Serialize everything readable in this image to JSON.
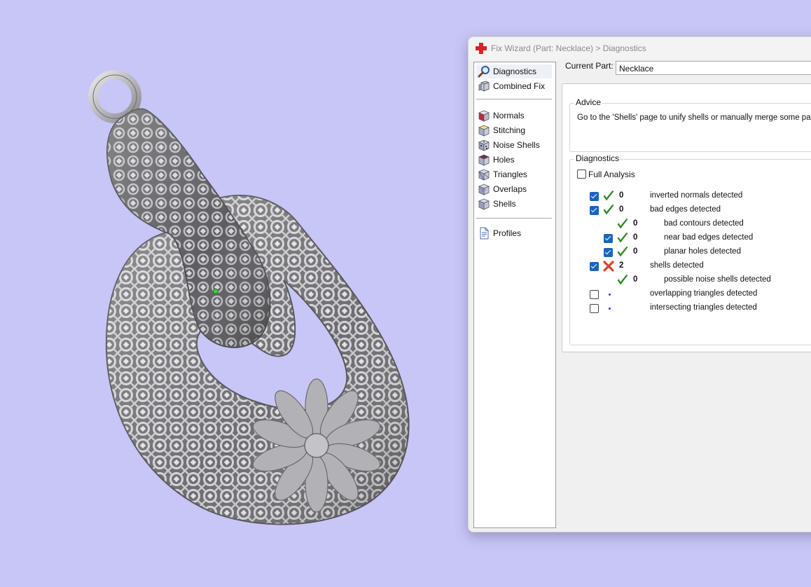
{
  "window": {
    "title": "Fix Wizard (Part: Necklace) > Diagnostics",
    "icon": "red-cross-icon"
  },
  "nav": {
    "groups": [
      [
        {
          "label": "Diagnostics",
          "icon": "magnifier-icon",
          "selected": true
        },
        {
          "label": "Combined Fix",
          "icon": "cubes-icon",
          "selected": false
        }
      ],
      [
        {
          "label": "Normals",
          "icon": "normals-cube-icon",
          "selected": false
        },
        {
          "label": "Stitching",
          "icon": "stitching-cube-icon",
          "selected": false
        },
        {
          "label": "Noise Shells",
          "icon": "noise-shells-cube-icon",
          "selected": false
        },
        {
          "label": "Holes",
          "icon": "holes-cube-icon",
          "selected": false
        },
        {
          "label": "Triangles",
          "icon": "triangles-cube-icon",
          "selected": false
        },
        {
          "label": "Overlaps",
          "icon": "overlaps-cube-icon",
          "selected": false
        },
        {
          "label": "Shells",
          "icon": "shells-cube-icon",
          "selected": false
        }
      ],
      [
        {
          "label": "Profiles",
          "icon": "document-icon",
          "selected": false
        }
      ]
    ]
  },
  "current_part": {
    "label": "Current Part:",
    "value": "Necklace"
  },
  "advice": {
    "title": "Advice",
    "text": "Go to the 'Shells' page to unify shells or manually merge some parts."
  },
  "diagnostics": {
    "title": "Diagnostics",
    "full_analysis": {
      "label": "Full Analysis",
      "checked": false
    },
    "rows": [
      {
        "checkbox": true,
        "checked": true,
        "indent": 0,
        "status": "ok",
        "count": "0",
        "label": "inverted normals detected"
      },
      {
        "checkbox": true,
        "checked": true,
        "indent": 0,
        "status": "ok",
        "count": "0",
        "label": "bad edges detected"
      },
      {
        "checkbox": false,
        "checked": false,
        "indent": 1,
        "status": "ok",
        "count": "0",
        "label": "bad contours detected"
      },
      {
        "checkbox": true,
        "checked": true,
        "indent": 1,
        "status": "ok",
        "count": "0",
        "label": "near bad edges detected"
      },
      {
        "checkbox": true,
        "checked": true,
        "indent": 1,
        "status": "ok",
        "count": "0",
        "label": "planar holes detected"
      },
      {
        "checkbox": true,
        "checked": true,
        "indent": 0,
        "status": "error",
        "count": "2",
        "label": "shells detected"
      },
      {
        "checkbox": false,
        "checked": false,
        "indent": 1,
        "status": "ok",
        "count": "0",
        "label": "possible noise shells detected"
      },
      {
        "checkbox": true,
        "checked": false,
        "indent": 0,
        "status": "none",
        "count": "",
        "label": "overlapping triangles detected"
      },
      {
        "checkbox": true,
        "checked": false,
        "indent": 0,
        "status": "none",
        "count": "",
        "label": "intersecting triangles detected"
      }
    ]
  },
  "viewport": {
    "background": "#c8c6f6",
    "model": "lattice-pendant-model"
  },
  "colors": {
    "ok_check": "#2e8b22",
    "error_cross": "#d8402a",
    "checkbox_checked": "#1665c0"
  }
}
